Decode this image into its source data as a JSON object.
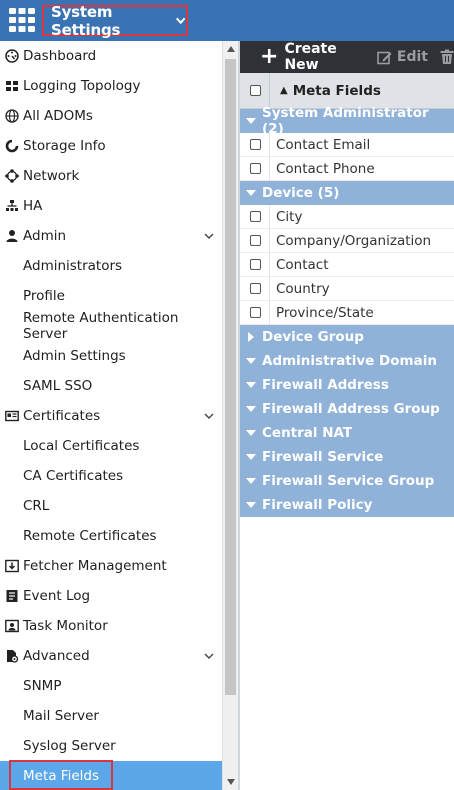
{
  "header": {
    "app_menu_label": "System Settings"
  },
  "sidebar": {
    "items": [
      {
        "label": "Dashboard",
        "icon": "dashboard-gauge-icon"
      },
      {
        "label": "Logging Topology",
        "icon": "topology-icon"
      },
      {
        "label": "All ADOMs",
        "icon": "globe-icon"
      },
      {
        "label": "Storage Info",
        "icon": "storage-icon"
      },
      {
        "label": "Network",
        "icon": "network-icon"
      },
      {
        "label": "HA",
        "icon": "ha-icon"
      },
      {
        "label": "Admin",
        "icon": "user-icon"
      },
      {
        "label": "Administrators"
      },
      {
        "label": "Profile"
      },
      {
        "label": "Remote Authentication Server"
      },
      {
        "label": "Admin Settings"
      },
      {
        "label": "SAML SSO"
      },
      {
        "label": "Certificates",
        "icon": "certificate-icon"
      },
      {
        "label": "Local Certificates"
      },
      {
        "label": "CA Certificates"
      },
      {
        "label": "CRL"
      },
      {
        "label": "Remote Certificates"
      },
      {
        "label": "Fetcher Management",
        "icon": "fetcher-icon"
      },
      {
        "label": "Event Log",
        "icon": "event-log-icon"
      },
      {
        "label": "Task Monitor",
        "icon": "task-monitor-icon"
      },
      {
        "label": "Advanced",
        "icon": "advanced-icon"
      },
      {
        "label": "SNMP"
      },
      {
        "label": "Mail Server"
      },
      {
        "label": "Syslog Server"
      },
      {
        "label": "Meta Fields"
      }
    ]
  },
  "toolbar": {
    "create_label": "Create New",
    "edit_label": "Edit"
  },
  "table": {
    "column_header": "Meta Fields",
    "groups": [
      {
        "label": "System Administrator (2)",
        "rows": [
          "Contact Email",
          "Contact Phone"
        ]
      },
      {
        "label": "Device (5)",
        "rows": [
          "City",
          "Company/Organization",
          "Contact",
          "Country",
          "Province/State"
        ]
      },
      {
        "label": "Device Group",
        "rows": []
      },
      {
        "label": "Administrative Domain",
        "rows": []
      },
      {
        "label": "Firewall Address",
        "rows": []
      },
      {
        "label": "Firewall Address Group",
        "rows": []
      },
      {
        "label": "Central NAT",
        "rows": []
      },
      {
        "label": "Firewall Service",
        "rows": []
      },
      {
        "label": "Firewall Service Group",
        "rows": []
      },
      {
        "label": "Firewall Policy",
        "rows": []
      }
    ]
  },
  "colors": {
    "header_blue": "#3a73b3",
    "group_blue": "#90b2d8",
    "active_item": "#5ba7ea",
    "toolbar_dark": "#2f3137",
    "highlight_red": "#d9363e"
  }
}
